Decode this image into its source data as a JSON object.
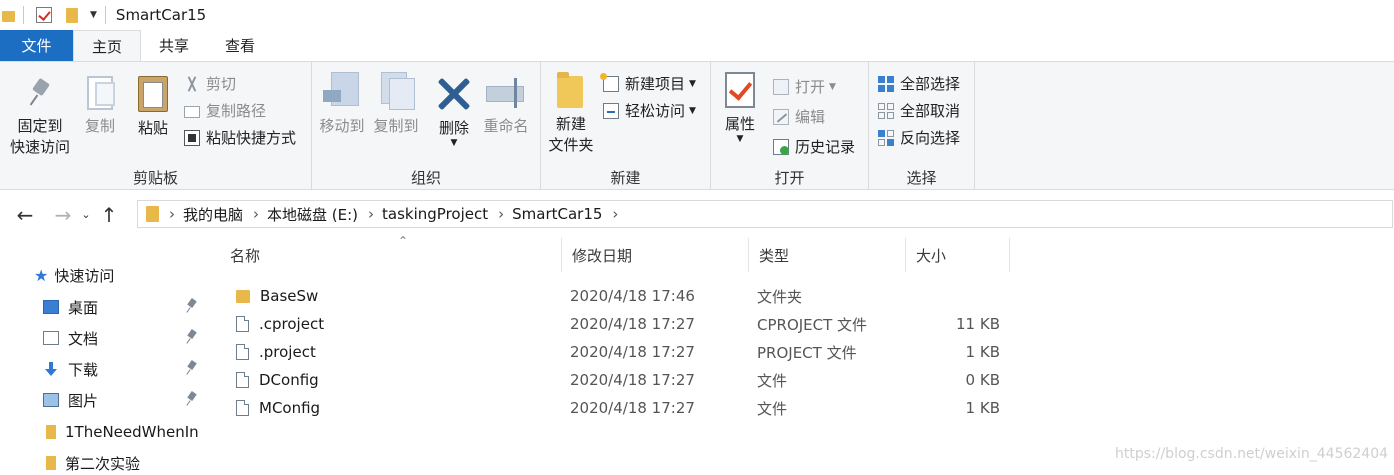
{
  "window": {
    "title": "SmartCar15"
  },
  "tabs": [
    {
      "label": "文件"
    },
    {
      "label": "主页"
    },
    {
      "label": "共享"
    },
    {
      "label": "查看"
    }
  ],
  "ribbon": {
    "clipboard": {
      "label": "剪贴板",
      "pin": "固定到\n快速访问",
      "pin_l1": "固定到",
      "pin_l2": "快速访问",
      "copy": "复制",
      "paste": "粘贴",
      "cut": "剪切",
      "copy_path": "复制路径",
      "paste_shortcut": "粘贴快捷方式"
    },
    "organize": {
      "label": "组织",
      "move_to": "移动到",
      "copy_to": "复制到",
      "delete": "删除",
      "rename": "重命名"
    },
    "new": {
      "label": "新建",
      "new_folder_l1": "新建",
      "new_folder_l2": "文件夹",
      "new_item": "新建项目",
      "easy_access": "轻松访问"
    },
    "open": {
      "label": "打开",
      "properties": "属性",
      "open": "打开",
      "edit": "编辑",
      "history": "历史记录"
    },
    "select": {
      "label": "选择",
      "select_all": "全部选择",
      "select_none": "全部取消",
      "invert": "反向选择"
    }
  },
  "address": {
    "crumbs": [
      "我的电脑",
      "本地磁盘 (E:)",
      "taskingProject",
      "SmartCar15"
    ]
  },
  "nav_pane": {
    "items": [
      {
        "label": "快速访问",
        "icon": "star-icon"
      },
      {
        "label": "桌面",
        "icon": "desktop-icon",
        "pinned": true
      },
      {
        "label": "文档",
        "icon": "documents-icon",
        "pinned": true
      },
      {
        "label": "下载",
        "icon": "download-icon",
        "pinned": true
      },
      {
        "label": "图片",
        "icon": "pictures-icon",
        "pinned": true
      },
      {
        "label": "1TheNeedWhenIn",
        "icon": "folder-icon"
      },
      {
        "label": "第二次实验",
        "icon": "folder-icon"
      }
    ]
  },
  "file_list": {
    "columns": [
      "名称",
      "修改日期",
      "类型",
      "大小"
    ],
    "rows": [
      {
        "name": "BaseSw",
        "modified": "2020/4/18 17:46",
        "type": "文件夹",
        "size": "",
        "icon": "folder-icon"
      },
      {
        "name": ".cproject",
        "modified": "2020/4/18 17:27",
        "type": "CPROJECT 文件",
        "size": "11 KB",
        "icon": "file-icon"
      },
      {
        "name": ".project",
        "modified": "2020/4/18 17:27",
        "type": "PROJECT 文件",
        "size": "1 KB",
        "icon": "file-icon"
      },
      {
        "name": "DConfig",
        "modified": "2020/4/18 17:27",
        "type": "文件",
        "size": "0 KB",
        "icon": "file-icon"
      },
      {
        "name": "MConfig",
        "modified": "2020/4/18 17:27",
        "type": "文件",
        "size": "1 KB",
        "icon": "file-icon"
      }
    ]
  },
  "watermark": "https://blog.csdn.net/weixin_44562404"
}
